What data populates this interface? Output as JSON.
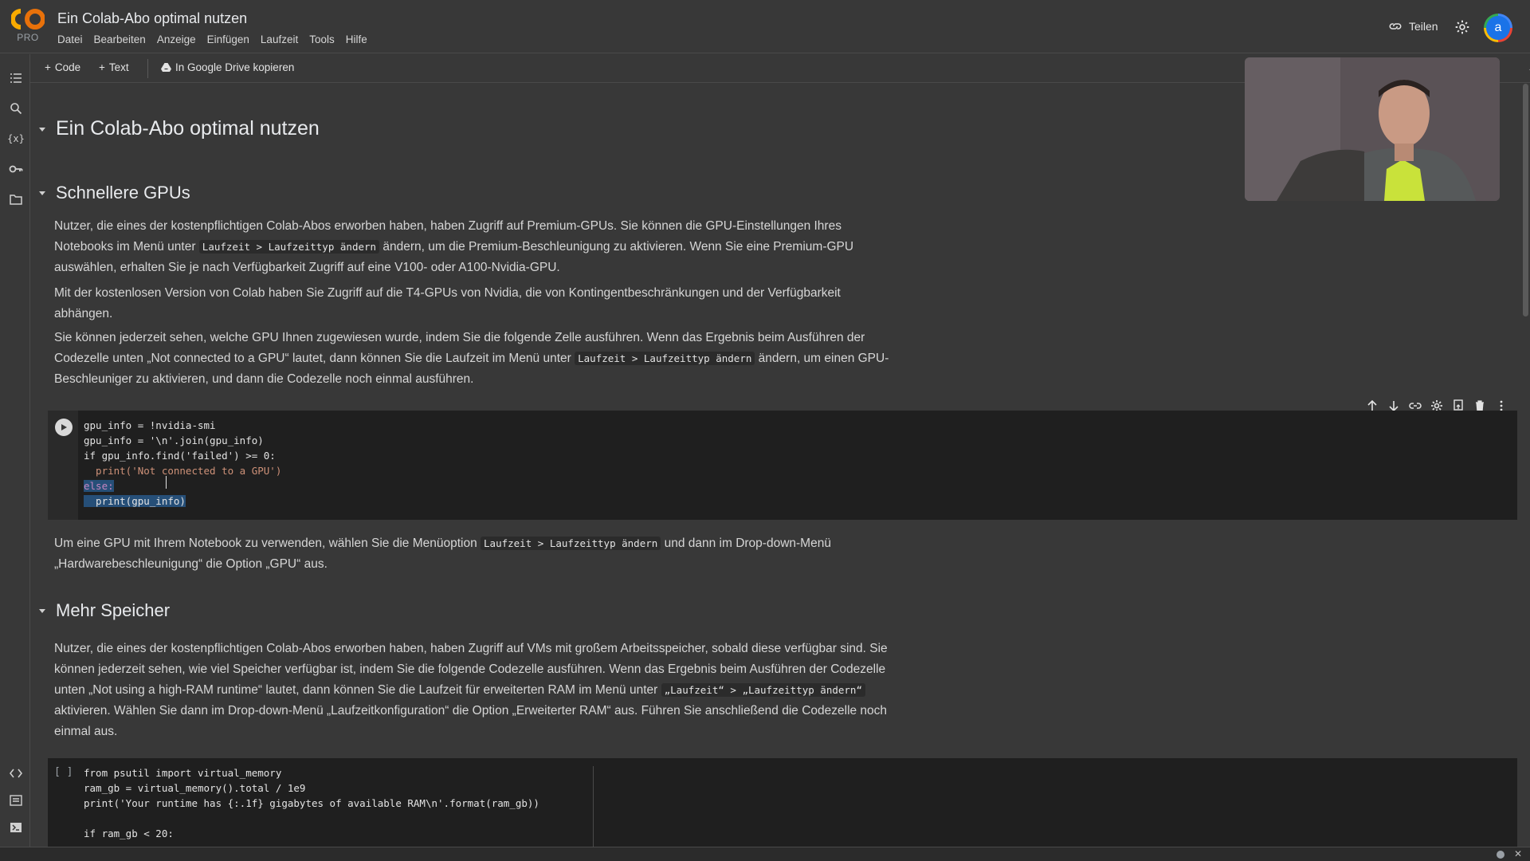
{
  "header": {
    "logo_text": "PRO",
    "notebook_title": "Ein Colab-Abo optimal nutzen",
    "menu": [
      "Datei",
      "Bearbeiten",
      "Anzeige",
      "Einfügen",
      "Laufzeit",
      "Tools",
      "Hilfe"
    ],
    "share_label": "Teilen",
    "avatar_letter": "a"
  },
  "toolbar": {
    "add_code_label": "Code",
    "add_text_label": "Text",
    "copy_drive_label": "In Google Drive kopieren"
  },
  "content": {
    "h1": "Ein Colab-Abo optimal nutzen",
    "section1": {
      "heading": "Schnellere GPUs",
      "p1_a": "Nutzer, die eines der kostenpflichtigen Colab-Abos erworben haben, haben Zugriff auf Premium-GPUs. Sie können die GPU-Einstellungen Ihres Notebooks im Menü unter ",
      "p1_code": "Laufzeit > Laufzeittyp ändern",
      "p1_b": " ändern, um die Premium-Beschleunigung zu aktivieren. Wenn Sie eine Premium-GPU auswählen, erhalten Sie je nach Verfügbarkeit Zugriff auf eine V100- oder A100-Nvidia-GPU.",
      "p2": "Mit der kostenlosen Version von Colab haben Sie Zugriff auf die T4-GPUs von Nvidia, die von Kontingentbeschränkungen und der Verfügbarkeit abhängen.",
      "p3_a": "Sie können jederzeit sehen, welche GPU Ihnen zugewiesen wurde, indem Sie die folgende Zelle ausführen. Wenn das Ergebnis beim Ausführen der Codezelle unten „Not connected to a GPU“ lautet, dann können Sie die Laufzeit im Menü unter ",
      "p3_code": "Laufzeit > Laufzeittyp ändern",
      "p3_b": " ändern, um einen GPU-Beschleuniger zu aktivieren, und dann die Codezelle noch einmal ausführen.",
      "code_lines": [
        "gpu_info = !nvidia-smi",
        "gpu_info = '\\n'.join(gpu_info)",
        "if gpu_info.find('failed') >= 0:",
        "  print('Not connected to a GPU')",
        "else:",
        "  print(gpu_info)"
      ],
      "p4_a": "Um eine GPU mit Ihrem Notebook zu verwenden, wählen Sie die Menüoption ",
      "p4_code": "Laufzeit > Laufzeittyp ändern",
      "p4_b": " und dann im Drop-down-Menü „Hardwarebeschleunigung“ die Option „GPU“ aus."
    },
    "section2": {
      "heading": "Mehr Speicher",
      "p1_a": "Nutzer, die eines der kostenpflichtigen Colab-Abos erworben haben, haben Zugriff auf VMs mit großem Arbeitsspeicher, sobald diese verfügbar sind. Sie können jederzeit sehen, wie viel Speicher verfügbar ist, indem Sie die folgende Codezelle ausführen. Wenn das Ergebnis beim Ausführen der Codezelle unten „Not using a high-RAM runtime“ lautet, dann können Sie die Laufzeit für erweiterten RAM im Menü unter ",
      "p1_code": "„Laufzeit“ > „Laufzeittyp ändern“",
      "p1_b": " aktivieren. Wählen Sie dann im Drop-down-Menü „Laufzeitkonfiguration“ die Option „Erweiterter RAM“ aus. Führen Sie anschließend die Codezelle noch einmal aus.",
      "exec_count": "[ ]",
      "code_lines": [
        "from psutil import virtual_memory",
        "ram_gb = virtual_memory().total / 1e9",
        "print('Your runtime has {:.1f} gigabytes of available RAM\\n'.format(ram_gb))",
        "",
        "if ram_gb < 20:"
      ]
    }
  },
  "colors": {
    "background": "#383838",
    "code_cell": "#1f1f1f",
    "text": "#d6d6d6",
    "selection": "#264f78"
  }
}
